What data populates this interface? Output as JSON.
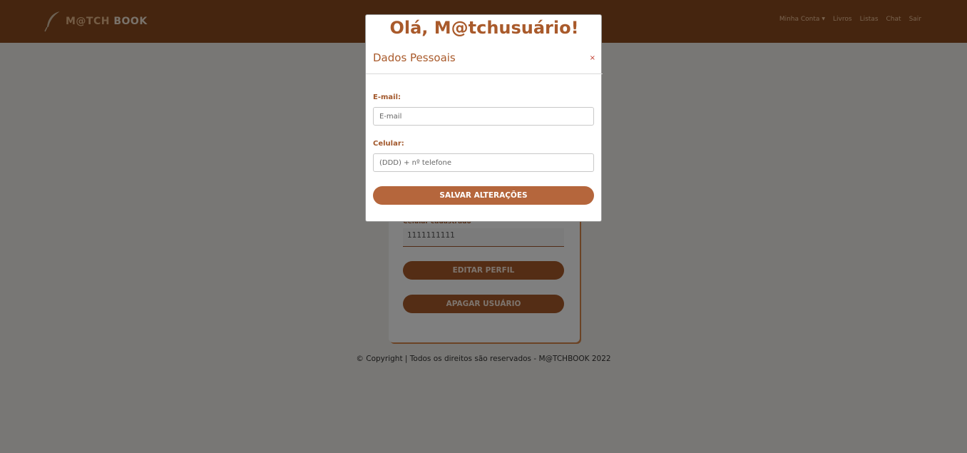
{
  "header": {
    "brand_at": "M@TCH",
    "brand_book": "BOOK",
    "nav": [
      "Minha Conta",
      "Livros",
      "Listas",
      "Chat",
      "Sair"
    ]
  },
  "profile": {
    "phone_label": "Celular cadastrado",
    "phone_value": "1111111111",
    "edit_label": "EDITAR PERFIL",
    "delete_label": "APAGAR USUÁRIO"
  },
  "footer": {
    "text": "© Copyright | Todos os direitos são reservados - M@TCHBOOK 2022"
  },
  "modal": {
    "greeting": "Olá, M@tchusuário!",
    "title": "Dados Pessoais",
    "close": "×",
    "email_label": "E-mail:",
    "email_placeholder": "E-mail",
    "phone_label": "Celular:",
    "phone_placeholder": "(DDD) + nº telefone",
    "save_label": "SALVAR ALTERAÇÕES"
  },
  "colors": {
    "navbar": "#8a4a1e",
    "accent": "#a95a2b",
    "nav_link": "#f2c79f"
  }
}
